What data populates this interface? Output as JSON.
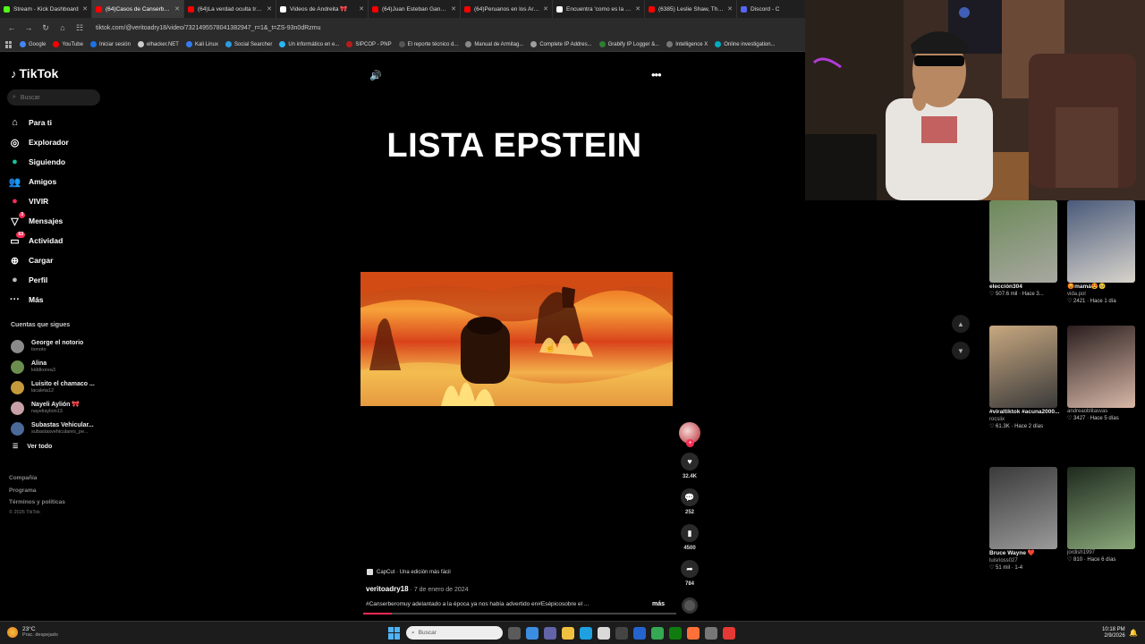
{
  "browser": {
    "tabs": [
      {
        "label": "Stream - Kick Dashboard",
        "color": "#53fc18",
        "active": false
      },
      {
        "label": "(64)Casos de Canserbero...",
        "color": "#ff0000",
        "active": true
      },
      {
        "label": "(64)La verdad oculta tras l...",
        "color": "#ff0000",
        "active": false
      },
      {
        "label": "Videos de Andreita 🎀",
        "color": "#ffffff",
        "active": false
      },
      {
        "label": "(64)Juan Esteban Gancoa",
        "color": "#ff0000",
        "active": false
      },
      {
        "label": "(64)Peruanos en los Archi...",
        "color": "#ff0000",
        "active": false
      },
      {
        "label": "Encuentra 'como es la el...",
        "color": "#ffffff",
        "active": false
      },
      {
        "label": "(6385) Leslie Shaw, Thalia...",
        "color": "#ff0000",
        "active": false
      },
      {
        "label": "Discord - C",
        "color": "#5865f2",
        "active": false
      }
    ],
    "url": "tiktok.com/@veritoadry18/video/7321495578041382947_r=1&_t=ZS-93n0dRzmu",
    "bookmarks": [
      {
        "label": "Google",
        "color": "#4285f4"
      },
      {
        "label": "YouTube",
        "color": "#ff0000"
      },
      {
        "label": "Iniciar sesión",
        "color": "#1a73e8"
      },
      {
        "label": "elhacker.NET",
        "color": "#cccccc"
      },
      {
        "label": "Kali Linux",
        "color": "#367bf0"
      },
      {
        "label": "Social Searcher",
        "color": "#2b9be5"
      },
      {
        "label": "Un informático en e...",
        "color": "#29b6f6"
      },
      {
        "label": "SIPCOP - PNP",
        "color": "#b71c1c"
      },
      {
        "label": "El reporte técnico d...",
        "color": "#555555"
      },
      {
        "label": "Manual de Armitag...",
        "color": "#888888"
      },
      {
        "label": "Complete IP Addres...",
        "color": "#9e9e9e"
      },
      {
        "label": "Grabify IP Logger &...",
        "color": "#2e7d32"
      },
      {
        "label": "Intelligence X",
        "color": "#777777"
      },
      {
        "label": "Online investigation...",
        "color": "#00acc1"
      }
    ]
  },
  "sidebar": {
    "logo": "TikTok",
    "search_placeholder": "Buscar",
    "nav": [
      {
        "label": "Para ti",
        "icon": "home-icon",
        "glyph": "⌂",
        "badge": ""
      },
      {
        "label": "Explorador",
        "icon": "compass-icon",
        "glyph": "◎",
        "badge": ""
      },
      {
        "label": "Siguiendo",
        "icon": "following-icon",
        "glyph": "●",
        "badge": ""
      },
      {
        "label": "Amigos",
        "icon": "friends-icon",
        "glyph": "👥",
        "badge": ""
      },
      {
        "label": "VIVIR",
        "icon": "live-icon",
        "glyph": "●",
        "badge": ""
      },
      {
        "label": "Mensajes",
        "icon": "messages-icon",
        "glyph": "▽",
        "badge": "3"
      },
      {
        "label": "Actividad",
        "icon": "activity-icon",
        "glyph": "▭",
        "badge": "63"
      },
      {
        "label": "Cargar",
        "icon": "upload-icon",
        "glyph": "⊕",
        "badge": ""
      },
      {
        "label": "Perfil",
        "icon": "profile-icon",
        "glyph": "●",
        "badge": ""
      },
      {
        "label": "Más",
        "icon": "more-icon",
        "glyph": "···",
        "badge": ""
      }
    ],
    "following_title": "Cuentas que sigues",
    "following": [
      {
        "name": "George el notorio",
        "user": "tionoto",
        "color": "#8a8a8a"
      },
      {
        "name": "Alina",
        "user": "kiddkorea3",
        "color": "#6b8e4e"
      },
      {
        "name": "Luisito el chamaco ...",
        "user": "lacaleta12",
        "color": "#c49a3a"
      },
      {
        "name": "Nayeli Aylión 🎀",
        "user": "nayeliaylion13",
        "color": "#c8a0a8"
      },
      {
        "name": "Subastas Vehicular...",
        "user": "subastasvehiculares_pe...",
        "color": "#4a6a9a"
      }
    ],
    "see_all": "Ver todo",
    "footer": [
      "Compañía",
      "Programa",
      "Términos y políticas"
    ],
    "copyright": "© 2026 TikTok"
  },
  "video": {
    "title": "LISTA EPSTEIN",
    "likes": "32.4K",
    "comments": "252",
    "saves": "4500",
    "shares": "784",
    "capcut": "CapCut · Una edición más fácil",
    "author": "veritoadry18",
    "date": " · 7 de enero de 2024",
    "caption": "#Canserberomuy adelantado a la época ya nos había advertido en#Esépicosobre el ...",
    "more": "más",
    "progress": 0.09
  },
  "grid": [
    {
      "title": "elección304",
      "user": "",
      "likes": "507.6 mil",
      "time": "Hace 3...",
      "c1": "#6d8a5a",
      "c2": "#a8a8a0"
    },
    {
      "title": "😡mamá😍🥺",
      "user": "vida.pol",
      "likes": "2421",
      "time": "Hace 1 día",
      "c1": "#4a5a7a",
      "c2": "#d8d4cc"
    },
    {
      "title": "#viraltiktok #acuna2000...",
      "user": "rocsiix",
      "likes": "61.3K",
      "time": "Hace 2 días",
      "c1": "#c8a880",
      "c2": "#3a3a3a"
    },
    {
      "title": "",
      "user": "andreaoblitasvas",
      "likes": "3427",
      "time": "Hace 5 días",
      "c1": "#2a1e1e",
      "c2": "#d8b8a8"
    },
    {
      "title": "Bruce Wayne ❤️",
      "user": "luisrioss027",
      "likes": "51 mil",
      "time": "1-4",
      "c1": "#3a3a3a",
      "c2": "#9a9a9a"
    },
    {
      "title": "",
      "user": "jordish1997",
      "likes": "810",
      "time": "Hace 6 días",
      "c1": "#1e2a1e",
      "c2": "#8aa87a"
    }
  ],
  "taskbar": {
    "temp": "23°C",
    "weather": "Prac. despejado",
    "search": "Buscar",
    "time": "10:18 PM",
    "date": "2/9/2026"
  }
}
